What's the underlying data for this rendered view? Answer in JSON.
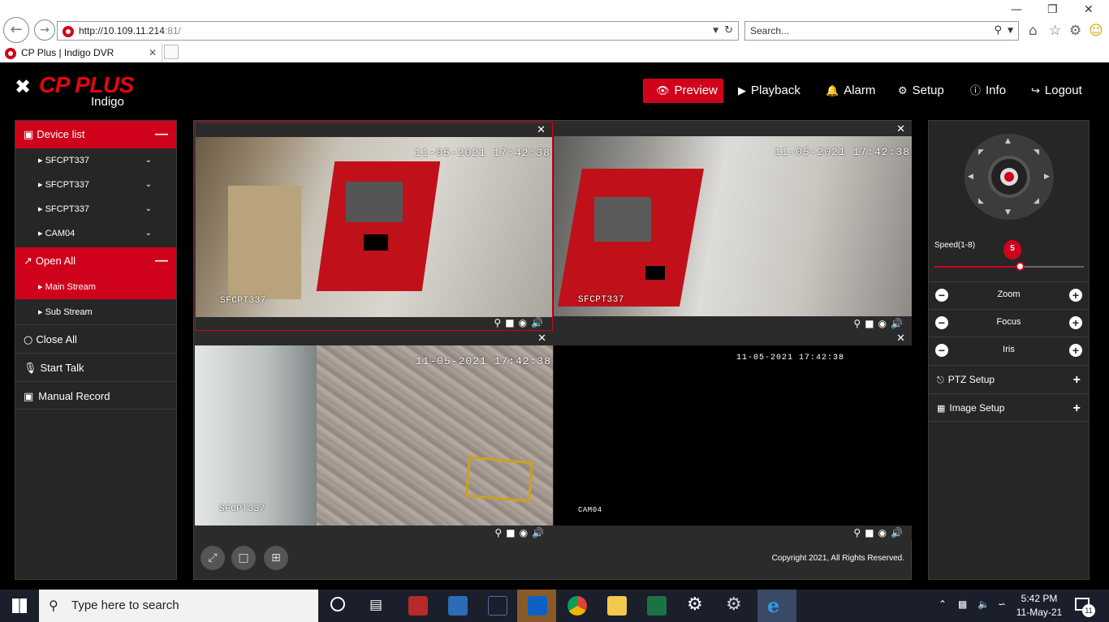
{
  "browser": {
    "url_host": "http://10.109.11.214",
    "url_port": ":81/",
    "search_placeholder": "Search...",
    "tab_title": "CP Plus | Indigo DVR"
  },
  "app": {
    "brand": "CP PLUS",
    "brand_sub": "Indigo",
    "menu": [
      "Preview",
      "Playback",
      "Alarm",
      "Setup",
      "Info",
      "Logout"
    ],
    "active_menu": "Preview"
  },
  "left": {
    "device_list_label": "Device list",
    "devices": [
      "SFCPT337",
      "SFCPT337",
      "SFCPT337",
      "CAM04"
    ],
    "open_all_label": "Open All",
    "streams": [
      "Main Stream",
      "Sub Stream"
    ],
    "selected_stream": "Main Stream",
    "close_all": "Close All",
    "start_talk": "Start Talk",
    "manual_record": "Manual Record"
  },
  "video": {
    "cells": [
      {
        "timestamp": "11-05-2021 17:42:38",
        "camera": "SFCPT337"
      },
      {
        "timestamp": "11-05-2021 17:42:38",
        "camera": "SFCPT337"
      },
      {
        "timestamp": "11-05-2021 17:42:38",
        "camera": "SFCPT337"
      },
      {
        "timestamp": "11-05-2021 17:42:38",
        "camera": "CAM04"
      }
    ],
    "copyright": "Copyright 2021, All Rights Reserved."
  },
  "ptz": {
    "speed_label": "Speed(1-8)",
    "speed_value": "5",
    "speed_fraction": 0.57,
    "zoom": "Zoom",
    "focus": "Focus",
    "iris": "Iris",
    "ptz_setup": "PTZ Setup",
    "image_setup": "Image Setup"
  },
  "taskbar": {
    "search_placeholder": "Type here to search",
    "time": "5:42 PM",
    "date": "11-May-21",
    "notifications": "11"
  },
  "colors": {
    "accent": "#d0021b",
    "panel": "#262626"
  }
}
